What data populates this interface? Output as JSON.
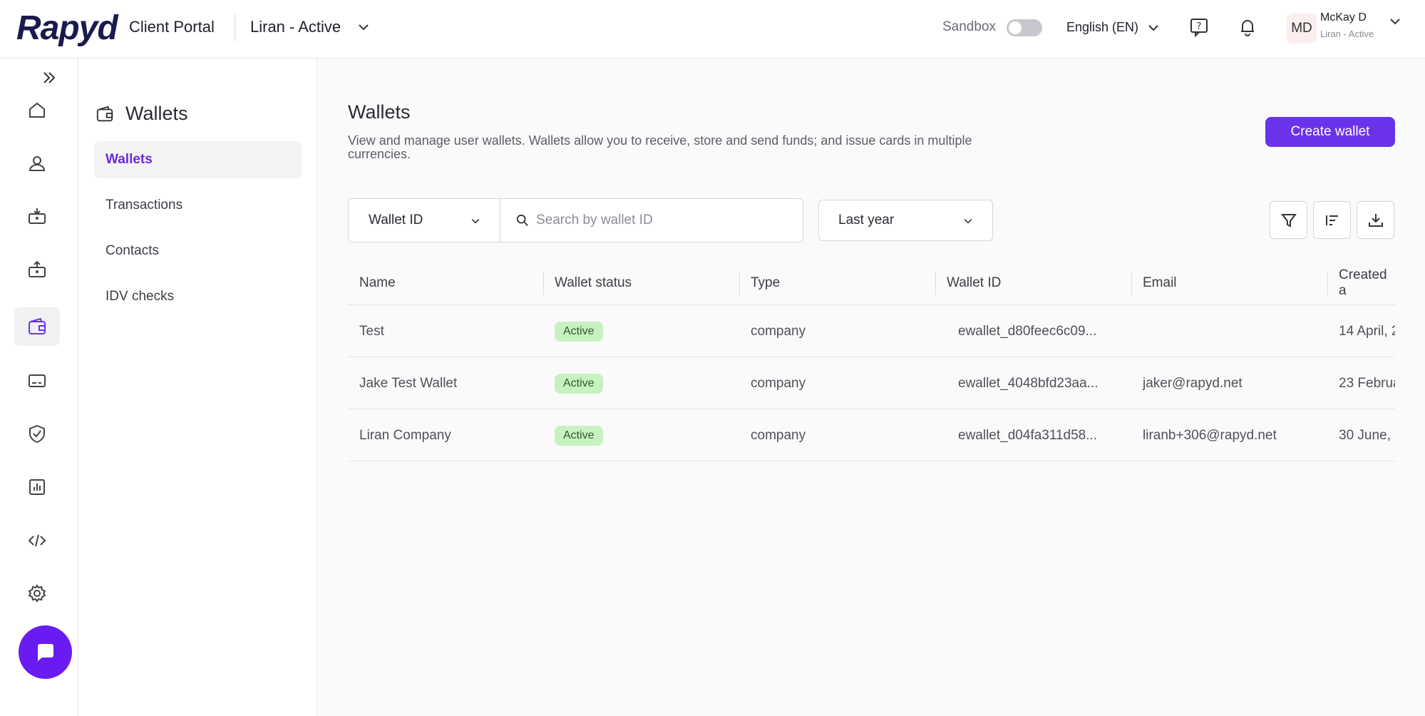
{
  "header": {
    "logo": "Rapyd",
    "portal_label": "Client Portal",
    "account": "Liran - Active",
    "sandbox_label": "Sandbox",
    "sandbox_on": false,
    "language": "English (EN)",
    "user_initials": "MD",
    "user_name": "McKay D",
    "user_account": "Liran - Active"
  },
  "rail": {
    "items": [
      {
        "icon": "home-icon"
      },
      {
        "icon": "user-icon"
      },
      {
        "icon": "collect-icon"
      },
      {
        "icon": "disburse-icon"
      },
      {
        "icon": "wallet-icon",
        "active": true
      },
      {
        "icon": "card-icon"
      },
      {
        "icon": "shield-check-icon"
      },
      {
        "icon": "reports-icon"
      },
      {
        "icon": "code-icon"
      },
      {
        "icon": "settings-icon"
      }
    ]
  },
  "subnav": {
    "title": "Wallets",
    "items": [
      {
        "label": "Wallets",
        "active": true
      },
      {
        "label": "Transactions"
      },
      {
        "label": "Contacts"
      },
      {
        "label": "IDV checks"
      }
    ]
  },
  "main": {
    "title": "Wallets",
    "description": "View and manage user wallets. Wallets allow you to receive, store and send funds; and issue cards in multiple currencies.",
    "create_button": "Create wallet",
    "field_select": "Wallet ID",
    "search_placeholder": "Search by wallet ID",
    "date_range": "Last year"
  },
  "table": {
    "columns": [
      "Name",
      "Wallet status",
      "Type",
      "Wallet ID",
      "Email",
      "Created a"
    ],
    "rows": [
      {
        "name": "Test",
        "status": "Active",
        "type": "company",
        "wallet_id": "ewallet_d80feec6c09...",
        "email": "",
        "created": "14 April, 2"
      },
      {
        "name": "Jake Test Wallet",
        "status": "Active",
        "type": "company",
        "wallet_id": "ewallet_4048bfd23aa...",
        "email": "jaker@rapyd.net",
        "created": "23 Februa"
      },
      {
        "name": "Liran Company",
        "status": "Active",
        "type": "company",
        "wallet_id": "ewallet_d04fa311d58...",
        "email": "liranb+306@rapyd.net",
        "created": "30 June, "
      }
    ]
  },
  "colors": {
    "accent": "#6a33ea",
    "chat_fab": "#6a1bf2",
    "active_badge_bg": "#c8f1c2",
    "logo": "#1b1a4f"
  }
}
